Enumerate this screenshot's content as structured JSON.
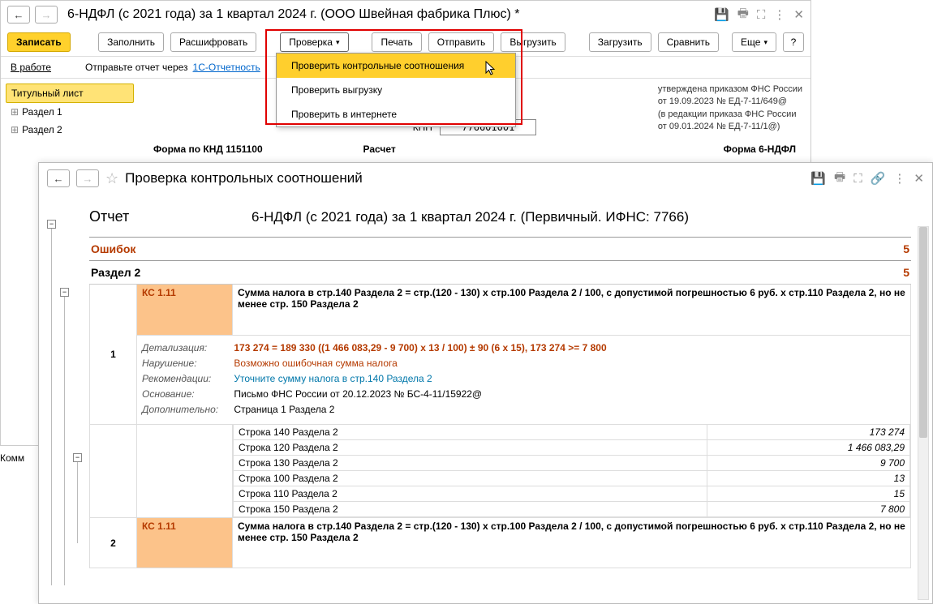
{
  "win1": {
    "title": "6-НДФЛ (с 2021 года) за 1 квартал 2024 г. (ООО Швейная фабрика Плюс) *",
    "toolbar": {
      "write": "Записать",
      "fill": "Заполнить",
      "decode": "Расшифровать",
      "check": "Проверка",
      "print": "Печать",
      "send": "Отправить",
      "export": "Выгрузить",
      "load": "Загрузить",
      "compare": "Сравнить",
      "more": "Еще"
    },
    "status": {
      "label": "В работе",
      "text": "Отправьте отчет через ",
      "link": "1С-Отчетность"
    },
    "sidebar": {
      "items": [
        "Титульный лист",
        "Раздел 1",
        "Раздел 2"
      ]
    },
    "form": {
      "knd": "Форма по КНД 1151100",
      "kpp_label": "КПП",
      "kpp_value": "776601001",
      "calc": "Расчет",
      "form_name": "Форма 6-НДФЛ",
      "note_l1": "утверждена приказом ФНС России",
      "note_l2": "от 19.09.2023 № ЕД-7-11/649@",
      "note_l3": "(в редакции приказа ФНС России",
      "note_l4": "от 09.01.2024 № ЕД-7-11/1@)"
    },
    "dropdown": {
      "i1": "Проверить контрольные соотношения",
      "i2": "Проверить выгрузку",
      "i3": "Проверить в интернете"
    },
    "comment": "Комм"
  },
  "win2": {
    "title": "Проверка контрольных соотношений",
    "report_label": "Отчет",
    "report_value": "6-НДФЛ (с 2021 года) за 1 квартал 2024 г. (Первичный. ИФНС: 7766)",
    "errors_label": "Ошибок",
    "errors_count": "5",
    "section_label": "Раздел 2",
    "section_count": "5",
    "ks_code": "КС 1.11",
    "row1": {
      "num": "1",
      "desc": "Сумма налога в стр.140 Раздела 2 = стр.(120 - 130) х стр.100 Раздела 2 / 100, с допустимой погрешностью 6 руб. х стр.110 Раздела 2, но не менее стр. 150 Раздела 2",
      "det_lbl": "Детализация:",
      "det_val": "173 274 = 189 330 ((1 466 083,29 - 9 700) х 13 / 100) ± 90 (6 х 15), 173 274 >= 7 800",
      "viol_lbl": "Нарушение:",
      "viol_val": "Возможно ошибочная сумма налога",
      "rec_lbl": "Рекомендации:",
      "rec_val": "Уточните сумму налога в стр.140 Раздела 2",
      "base_lbl": "Основание:",
      "base_val": "Письмо ФНС России от 20.12.2023 № БС-4-11/15922@",
      "add_lbl": "Дополнительно:",
      "add_val": "Страница 1 Раздела 2"
    },
    "lines": [
      {
        "name": "Строка 140 Раздела 2",
        "val": "173 274"
      },
      {
        "name": "Строка 120 Раздела 2",
        "val": "1 466 083,29"
      },
      {
        "name": "Строка 130 Раздела 2",
        "val": "9 700"
      },
      {
        "name": "Строка 100 Раздела 2",
        "val": "13"
      },
      {
        "name": "Строка 110 Раздела 2",
        "val": "15"
      },
      {
        "name": "Строка 150 Раздела 2",
        "val": "7 800"
      }
    ],
    "row2": {
      "num": "2",
      "desc": "Сумма налога в стр.140 Раздела 2 = стр.(120 - 130) х стр.100 Раздела 2 / 100, с допустимой погрешностью 6 руб. х стр.110 Раздела 2, но не менее стр. 150 Раздела 2"
    }
  }
}
